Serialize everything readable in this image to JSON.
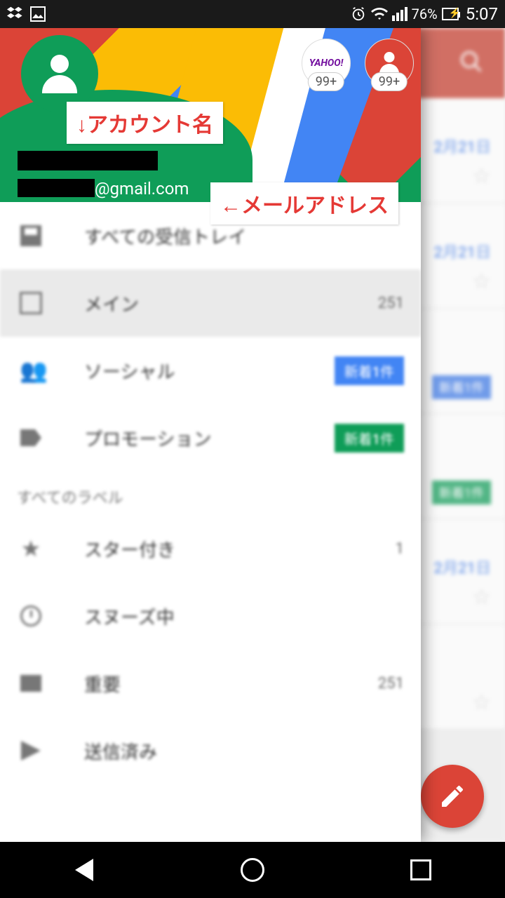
{
  "status": {
    "battery": "76%",
    "time": "5:07"
  },
  "accounts": {
    "main_avatar_color": "#0f9d58",
    "alt1_label": "YAHOO!",
    "alt1_badge": "99+",
    "alt2_badge": "99+",
    "email_domain": "@gmail.com"
  },
  "annotations": {
    "account_name": "↓アカウント名",
    "email_address": "←メールアドレス"
  },
  "drawer": {
    "items": [
      {
        "label": "すべての受信トレイ",
        "icon": "all-inbox-icon",
        "count": ""
      },
      {
        "label": "メイン",
        "icon": "inbox-icon",
        "count": "251",
        "selected": true
      },
      {
        "label": "ソーシャル",
        "icon": "people-icon",
        "badge": "新着1件",
        "badge_color": "blue"
      },
      {
        "label": "プロモーション",
        "icon": "tag-icon",
        "badge": "新着1件",
        "badge_color": "green"
      }
    ],
    "section_label": "すべてのラベル",
    "labels": [
      {
        "label": "スター付き",
        "icon": "star-icon",
        "count": "1"
      },
      {
        "label": "スヌーズ中",
        "icon": "clock-icon",
        "count": ""
      },
      {
        "label": "重要",
        "icon": "label-icon",
        "count": "251"
      },
      {
        "label": "送信済み",
        "icon": "send-icon",
        "count": ""
      }
    ]
  },
  "background": {
    "dates": [
      "2月21日",
      "2月21日",
      "2月21日"
    ],
    "badge_blue": "新着1件",
    "badge_green": "新着1件"
  }
}
